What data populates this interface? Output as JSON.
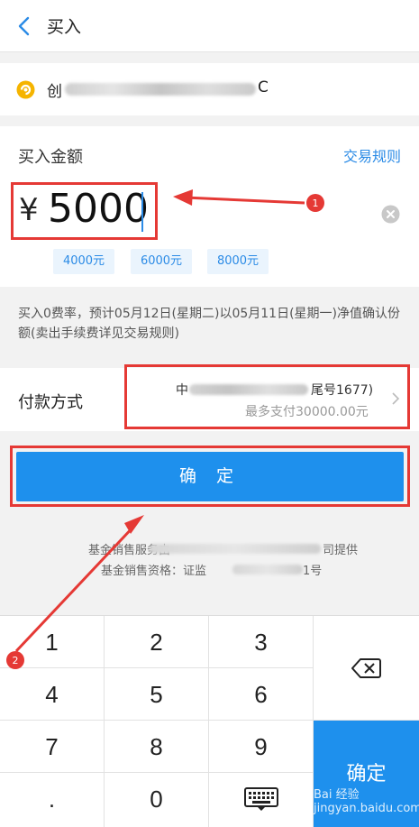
{
  "header": {
    "title": "买入"
  },
  "fund": {
    "name_prefix": "创",
    "name_suffix": "C"
  },
  "amount": {
    "label": "买入金额",
    "rules_link": "交易规则",
    "currency": "¥",
    "value": "5000",
    "presets": [
      "4000元",
      "6000元",
      "8000元"
    ]
  },
  "note": "买入0费率，预计05月12日(星期二)以05月11日(星期一)净值确认份额(卖出手续费详见交易规则)",
  "payment": {
    "label": "付款方式",
    "bank_prefix": "中",
    "bank_suffix": "尾号1677)",
    "limit": "最多支付30000.00元"
  },
  "confirm_button": "确 定",
  "service": {
    "line1_prefix": "基金销售服务由",
    "line1_suffix": "司提供",
    "line2_prefix": "基金销售资格：证监",
    "line2_suffix": "1号"
  },
  "keypad": {
    "keys": [
      "1",
      "2",
      "3",
      "4",
      "5",
      "6",
      "7",
      "8",
      "9",
      ".",
      "0"
    ],
    "confirm": "确定",
    "delete_icon": "backspace-icon",
    "keyboard_icon": "keyboard-hide-icon"
  },
  "annotations": {
    "badge1": "1",
    "badge2": "2"
  },
  "watermark": "Bai 经验 jingyan.baidu.com",
  "colors": {
    "accent": "#1e90ed",
    "link": "#2b8be6",
    "highlight": "#e53935"
  }
}
